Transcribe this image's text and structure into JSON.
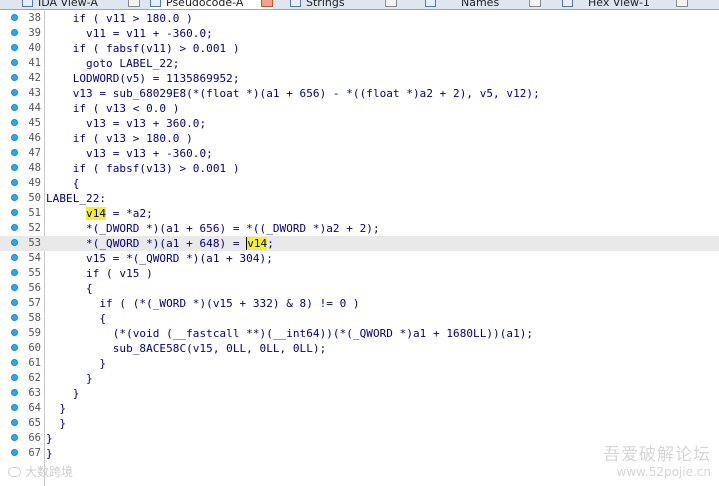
{
  "tabs": [
    {
      "label": "IDA View-A",
      "active": false,
      "icon": "ida-view-icon"
    },
    {
      "label": "Pseudocode-A",
      "active": true,
      "icon": "pseudocode-icon"
    },
    {
      "label": "Strings",
      "active": false,
      "icon": "strings-icon"
    },
    {
      "label": "Names",
      "active": false,
      "icon": "names-icon"
    },
    {
      "label": "Hex View-1",
      "active": false,
      "icon": "hex-view-icon"
    }
  ],
  "lines": [
    {
      "num": "38",
      "text": "    if ( v11 > 180.0 )"
    },
    {
      "num": "39",
      "text": "      v11 = v11 + -360.0;"
    },
    {
      "num": "40",
      "text": "    if ( fabsf(v11) > 0.001 )"
    },
    {
      "num": "41",
      "text": "      goto LABEL_22;"
    },
    {
      "num": "42",
      "text": "    LODWORD(v5) = 1135869952;"
    },
    {
      "num": "43",
      "text": "    v13 = sub_68029E8(*(float *)(a1 + 656) - *((float *)a2 + 2), v5, v12);"
    },
    {
      "num": "44",
      "text": "    if ( v13 < 0.0 )"
    },
    {
      "num": "45",
      "text": "      v13 = v13 + 360.0;"
    },
    {
      "num": "46",
      "text": "    if ( v13 > 180.0 )"
    },
    {
      "num": "47",
      "text": "      v13 = v13 + -360.0;"
    },
    {
      "num": "48",
      "text": "    if ( fabsf(v13) > 0.001 )"
    },
    {
      "num": "49",
      "text": "    {"
    },
    {
      "num": "50",
      "text": "LABEL_22:"
    },
    {
      "num": "51",
      "text": "      v14 = *a2;"
    },
    {
      "num": "52",
      "text": "      *(_DWORD *)(a1 + 656) = *((_DWORD *)a2 + 2);"
    },
    {
      "num": "53",
      "text": "      *(_QWORD *)(a1 + 648) = v14;"
    },
    {
      "num": "54",
      "text": "      v15 = *(_QWORD *)(a1 + 304);"
    },
    {
      "num": "55",
      "text": "      if ( v15 )"
    },
    {
      "num": "56",
      "text": "      {"
    },
    {
      "num": "57",
      "text": "        if ( (*(_WORD *)(v15 + 332) & 8) != 0 )"
    },
    {
      "num": "58",
      "text": "        {"
    },
    {
      "num": "59",
      "text": "          (*(void (__fastcall **)(__int64))(*(_QWORD *)a1 + 1680LL))(a1);"
    },
    {
      "num": "60",
      "text": "          sub_8ACE58C(v15, 0LL, 0LL, 0LL);"
    },
    {
      "num": "61",
      "text": "        }"
    },
    {
      "num": "62",
      "text": "      }"
    },
    {
      "num": "63",
      "text": "    }"
    },
    {
      "num": "64",
      "text": "  }"
    },
    {
      "num": "65",
      "text": "  }"
    },
    {
      "num": "66",
      "text": "}"
    },
    {
      "num": "67",
      "text": "}"
    }
  ],
  "highlight_word": "v14",
  "highlight_lines": [
    "51",
    "53"
  ],
  "current_line": "53",
  "colors": {
    "breakpoint_dot": "#2aa8f0",
    "highlight": "#f6f02a",
    "current_line_bg": "#e9e9e9",
    "code_text": "#000080"
  },
  "watermark": {
    "left": "大数跨境",
    "right_title": "吾爱破解论坛",
    "right_url": "www.52pojie.cn"
  }
}
